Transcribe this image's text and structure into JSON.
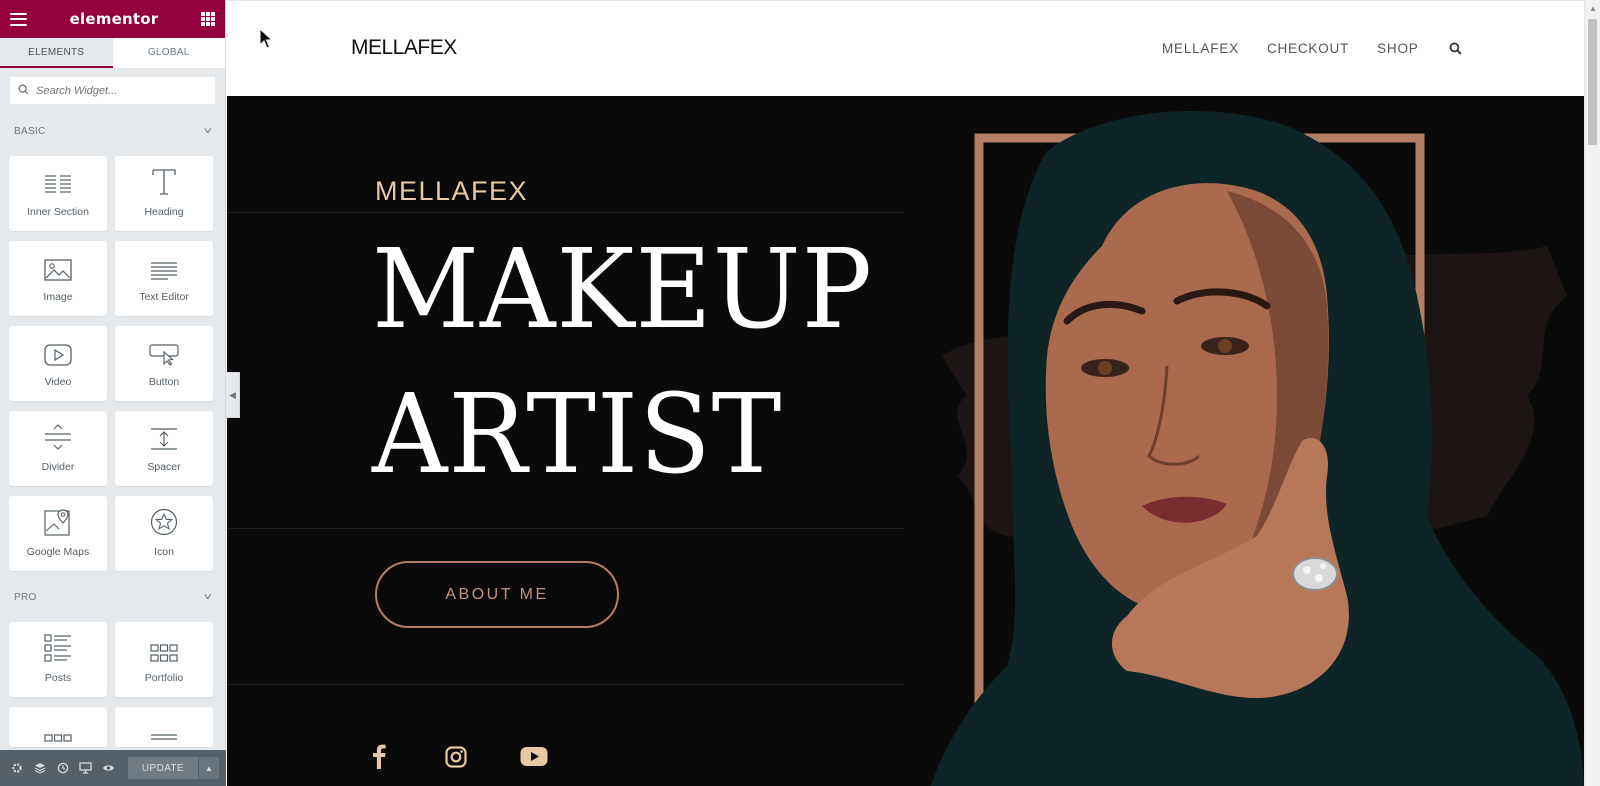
{
  "panel": {
    "brand": "elementor",
    "tabs": [
      "ELEMENTS",
      "GLOBAL"
    ],
    "search_placeholder": "Search Widget...",
    "categories": [
      {
        "name": "BASIC",
        "widgets": [
          {
            "label": "Inner Section",
            "icon": "inner-section-icon"
          },
          {
            "label": "Heading",
            "icon": "heading-icon"
          },
          {
            "label": "Image",
            "icon": "image-icon"
          },
          {
            "label": "Text Editor",
            "icon": "text-editor-icon"
          },
          {
            "label": "Video",
            "icon": "video-icon"
          },
          {
            "label": "Button",
            "icon": "button-icon"
          },
          {
            "label": "Divider",
            "icon": "divider-icon"
          },
          {
            "label": "Spacer",
            "icon": "spacer-icon"
          },
          {
            "label": "Google Maps",
            "icon": "google-maps-icon"
          },
          {
            "label": "Icon",
            "icon": "star-icon"
          }
        ]
      },
      {
        "name": "PRO",
        "widgets": [
          {
            "label": "Posts",
            "icon": "posts-icon"
          },
          {
            "label": "Portfolio",
            "icon": "portfolio-icon"
          }
        ]
      }
    ],
    "footer": {
      "update_label": "UPDATE",
      "icons": [
        "settings-icon",
        "navigator-icon",
        "history-icon",
        "responsive-icon",
        "preview-icon"
      ]
    }
  },
  "site": {
    "logo": "MELLAFEX",
    "nav": [
      "MELLAFEX",
      "CHECKOUT",
      "SHOP"
    ],
    "hero": {
      "kicker": "MELLAFEX",
      "title_line1": "MAKEUP",
      "title_line2": "ARTIST",
      "button": "ABOUT ME",
      "social": [
        "facebook-icon",
        "instagram-icon",
        "youtube-icon"
      ]
    }
  },
  "colors": {
    "elementor_brand": "#93003c",
    "hero_background": "#0a0a0a",
    "accent_gold": "#e8c9a6",
    "frame_bronze": "#b27f64"
  }
}
